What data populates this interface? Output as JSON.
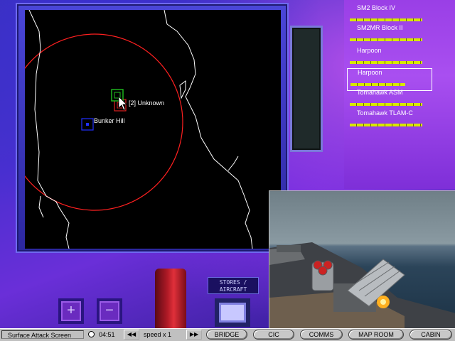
{
  "map": {
    "contacts": [
      {
        "label": "[2] Unknown",
        "type": "unknown"
      },
      {
        "label": "Bunker Hill",
        "type": "friendly"
      }
    ]
  },
  "weapons": {
    "items": [
      {
        "label": "SM2 Block IV",
        "level": 1.0,
        "selected": false
      },
      {
        "label": "SM2MR Block II",
        "level": 1.0,
        "selected": false
      },
      {
        "label": "Harpoon",
        "level": 1.0,
        "selected": false
      },
      {
        "label": "Harpoon",
        "level": 0.75,
        "selected": true
      },
      {
        "label": "Tomahawk ASM",
        "level": 1.0,
        "selected": false
      },
      {
        "label": "Tomahawk TLAM-C",
        "level": 1.0,
        "selected": false
      }
    ],
    "bar_color": "#d8e800"
  },
  "controls": {
    "zoom_in_label": "+",
    "zoom_out_label": "−",
    "stores_label_line1": "STORES /",
    "stores_label_line2": "AIRCRAFT"
  },
  "statusbar": {
    "screen_name": "Surface Attack Screen",
    "clock": "04:51",
    "rewind_label": "◀◀",
    "speed": "speed x 1",
    "forward_label": "▶▶",
    "nav": [
      "BRIDGE",
      "CIC",
      "COMMS",
      "MAP ROOM",
      "CABIN"
    ]
  },
  "colors": {
    "range_ring": "#ff2020",
    "coastline": "#ffffff",
    "friendly": "#2030ff",
    "unknown_top": "#20c020",
    "unknown_bottom": "#e02020"
  }
}
